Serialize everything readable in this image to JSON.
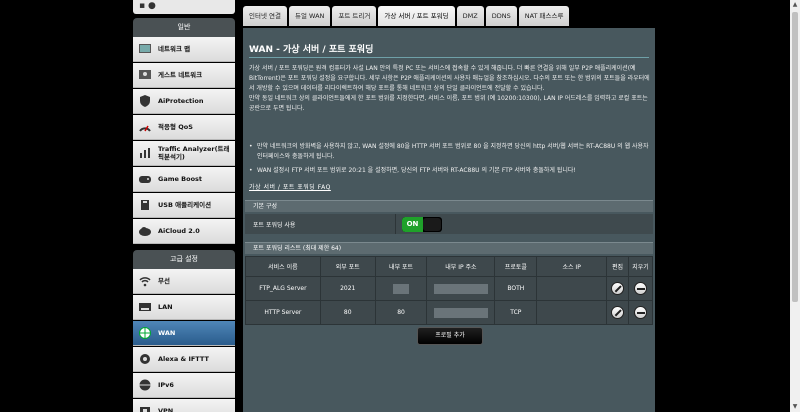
{
  "sidebar": {
    "general_title": "일반",
    "advanced_title": "고급 설정",
    "general_items": [
      {
        "label": "네트워크 맵",
        "icon": "network-map-icon"
      },
      {
        "label": "게스트 네트워크",
        "icon": "guest-network-icon"
      },
      {
        "label": "AiProtection",
        "icon": "aiprotection-icon"
      },
      {
        "label": "적응형 QoS",
        "icon": "qos-icon"
      },
      {
        "label": "Traffic Analyzer(트래픽분석기)",
        "icon": "traffic-analyzer-icon"
      },
      {
        "label": "Game Boost",
        "icon": "gamepad-icon"
      },
      {
        "label": "USB 애플리케이션",
        "icon": "usb-icon"
      },
      {
        "label": "AiCloud 2.0",
        "icon": "cloud-icon"
      }
    ],
    "advanced_items": [
      {
        "label": "무선",
        "icon": "wireless-icon"
      },
      {
        "label": "LAN",
        "icon": "lan-icon"
      },
      {
        "label": "WAN",
        "icon": "wan-globe-icon",
        "active": true
      },
      {
        "label": "Alexa & IFTTT",
        "icon": "alexa-icon"
      },
      {
        "label": "IPv6",
        "icon": "ipv6-icon"
      },
      {
        "label": "VPN",
        "icon": "vpn-icon"
      }
    ]
  },
  "tabs": [
    {
      "label": "인터넷 연결"
    },
    {
      "label": "듀얼 WAN"
    },
    {
      "label": "포트 트리거"
    },
    {
      "label": "가상 서버 / 포트 포워딩",
      "active": true
    },
    {
      "label": "DMZ"
    },
    {
      "label": "DDNS"
    },
    {
      "label": "NAT 패스스루"
    }
  ],
  "main": {
    "title": "WAN - 가상 서버 / 포트 포워딩",
    "description_1": "가상 서버 / 포트 포워딩은 원격 컴퓨터가 사설 LAN 안의 특정 PC 또는 서비스에 접속할 수 있게 해줍니다. 더 빠른 연결을 위해 일부 P2P 애플리케이션(예 BitTorrent)은 포트 포워딩 설정을 요구합니다. 세부 사항은 P2P 애플리케이션의 사용자 매뉴얼을 참조하십시오. 다수의 포트 또는 한 범위의 포트들을 라우터에서 개방할 수 있으며 데이터를 리다이렉트하여 해당 포트를 통해 네트워크 상의 단일 클라이언트에 전달할 수 있습니다.",
    "description_2": "만약 동일 네트워크 상의 클라이언트들에게 한 포트 범위를 지정한다면, 서비스 이름, 포트 범위 (예 10200:10300), LAN IP 어드레스를 입력하고 로컬 포트는 공란으로 두면 됩니다.",
    "bullet_1": "만약 네트워크의 방화벽을 사용하지 않고, WAN 설정에 80을 HTTP 서버 포트 범위로 80 을 지정하면 당신의 http 서버/웹 서버는 RT-AC88U 의 웹 사용자 인터페이스와 충돌하게 됩니다.",
    "bullet_2": "WAN 설정시 FTP 서버 포트 범위로 20:21 을 설정하면, 당신의 FTP 서버와 RT-AC88U 의 기본 FTP 서버와 충돌하게 됩니다!",
    "faq_link": "가상 서버 / 포트 포워딩 FAQ",
    "basic_config_title": "기본 구성",
    "port_forwarding_label": "포트 포워딩 사용",
    "toggle_state": "ON",
    "list_title": "포트 포워딩 리스트 (최대 제한 64)",
    "columns": [
      "서비스 이름",
      "외부 포트",
      "내부 포트",
      "내부 IP 주소",
      "프로토콜",
      "소스 IP",
      "편집",
      "지우기"
    ],
    "rows": [
      {
        "service": "FTP_ALG Server",
        "external_port": "2021",
        "internal_port": "",
        "ip": "",
        "protocol": "BOTH",
        "source_ip": ""
      },
      {
        "service": "HTTP Server",
        "external_port": "80",
        "internal_port": "80",
        "ip": "",
        "protocol": "TCP",
        "source_ip": ""
      }
    ],
    "add_profile_label": "프로필 추가"
  }
}
